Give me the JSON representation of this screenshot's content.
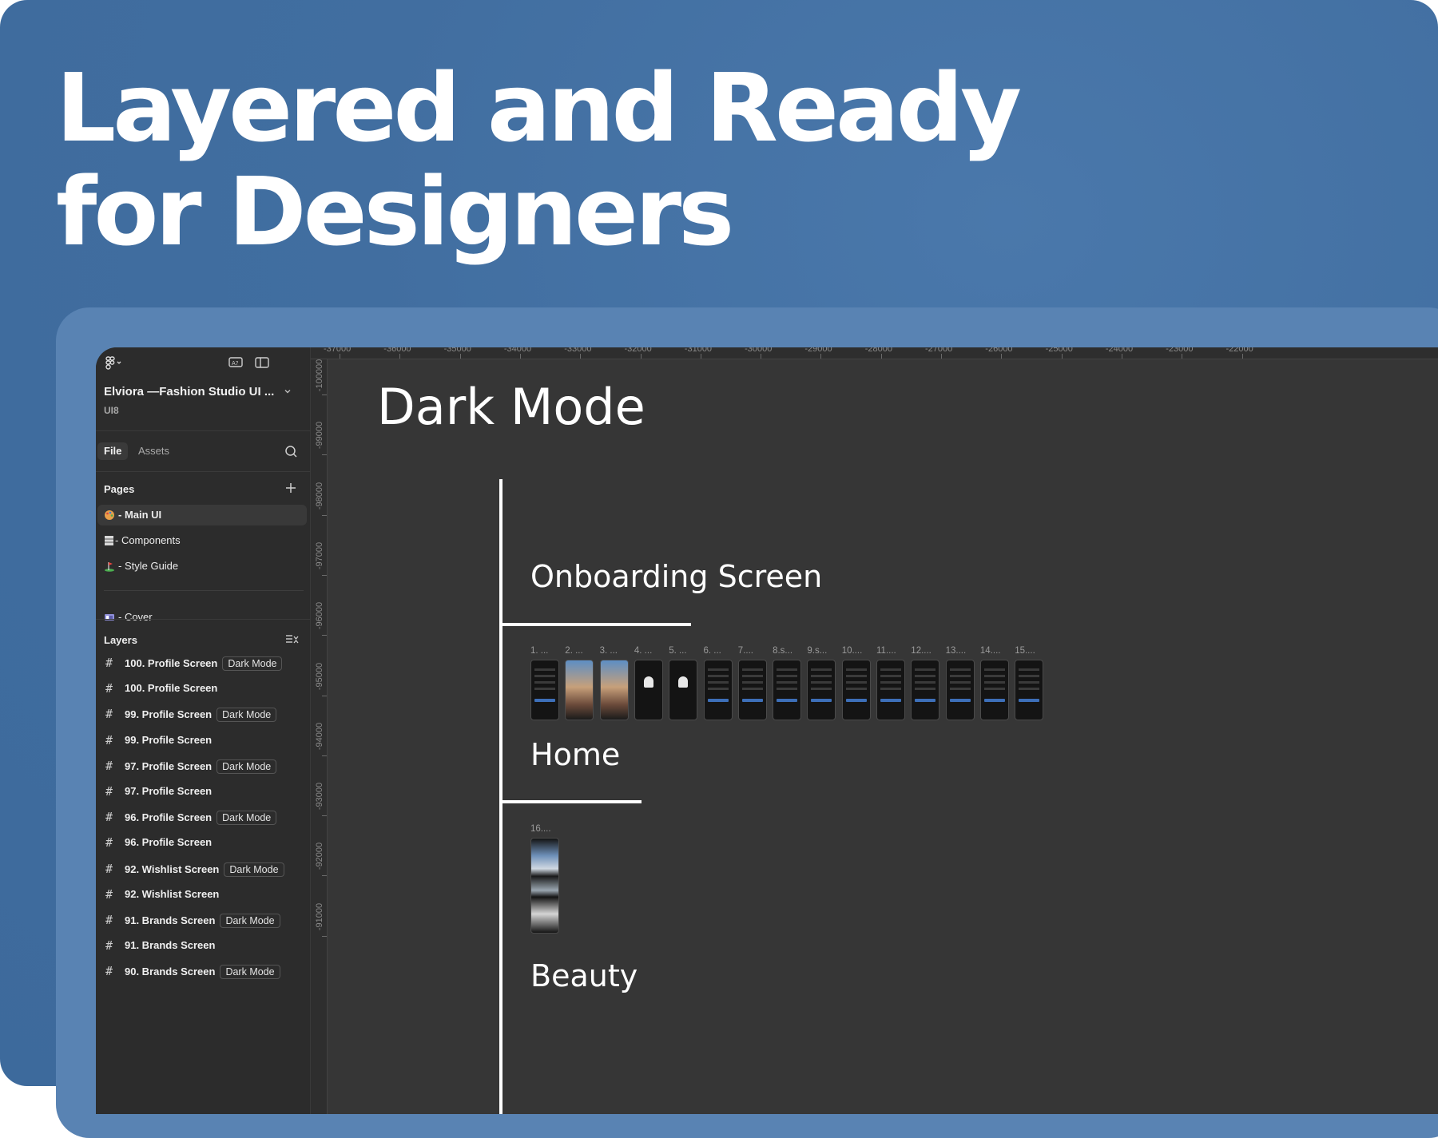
{
  "headline": {
    "line1": "Layered and Ready",
    "line2": "for Designers"
  },
  "project": {
    "name": "Elviora —Fashion Studio UI ...",
    "sub": "UI8"
  },
  "tabs": {
    "file": "File",
    "assets": "Assets"
  },
  "pages": {
    "header": "Pages",
    "items": [
      {
        "label": "- Main UI",
        "icon": "palette-icon",
        "selected": true
      },
      {
        "label": "- Components",
        "icon": "components-icon",
        "selected": false
      },
      {
        "label": "- Style Guide",
        "icon": "golf-flag-icon",
        "selected": false
      },
      {
        "label": "- Cover",
        "icon": "cover-icon",
        "selected": false
      }
    ]
  },
  "layers": {
    "header": "Layers",
    "items": [
      {
        "name": "100. Profile Screen",
        "badge": "Dark Mode"
      },
      {
        "name": "100. Profile Screen",
        "badge": ""
      },
      {
        "name": "99. Profile Screen",
        "badge": "Dark Mode"
      },
      {
        "name": "99. Profile Screen",
        "badge": ""
      },
      {
        "name": "97. Profile Screen",
        "badge": "Dark Mode"
      },
      {
        "name": "97. Profile Screen",
        "badge": ""
      },
      {
        "name": "96. Profile Screen",
        "badge": "Dark Mode"
      },
      {
        "name": "96. Profile Screen",
        "badge": ""
      },
      {
        "name": "92. Wishlist Screen",
        "badge": "Dark Mode"
      },
      {
        "name": "92. Wishlist Screen",
        "badge": ""
      },
      {
        "name": "91. Brands Screen",
        "badge": "Dark Mode"
      },
      {
        "name": "91. Brands Screen",
        "badge": ""
      },
      {
        "name": "90. Brands Screen",
        "badge": "Dark Mode"
      }
    ]
  },
  "ruler": {
    "top": [
      "-37000",
      "-36000",
      "-35000",
      "-34000",
      "-33000",
      "-32000",
      "-31000",
      "-30000",
      "-29000",
      "-28000",
      "-27000",
      "-26000",
      "-25000",
      "-24000",
      "-23000",
      "-22000"
    ],
    "left": [
      "-100000",
      "-99000",
      "-98000",
      "-97000",
      "-96000",
      "-95000",
      "-94000",
      "-93000",
      "-92000",
      "-91000"
    ]
  },
  "canvas": {
    "title": "Dark Mode",
    "sections": [
      {
        "label": "Onboarding Screen"
      },
      {
        "label": "Home"
      },
      {
        "label": "Beauty"
      }
    ],
    "onboarding_thumbs": [
      "1. ...",
      "2. ...",
      "3. ...",
      "4. ...",
      "5. ...",
      "6. ...",
      "7....",
      "8.s...",
      "9.s...",
      "10....",
      "11....",
      "12....",
      "13....",
      "14....",
      "15...."
    ],
    "home_thumbs": [
      "16...."
    ]
  },
  "colors": {
    "background": "#416ea0",
    "frame": "#5983b3",
    "panel": "#2c2c2c",
    "canvas": "#363636",
    "accent": "#3d6fb8"
  }
}
